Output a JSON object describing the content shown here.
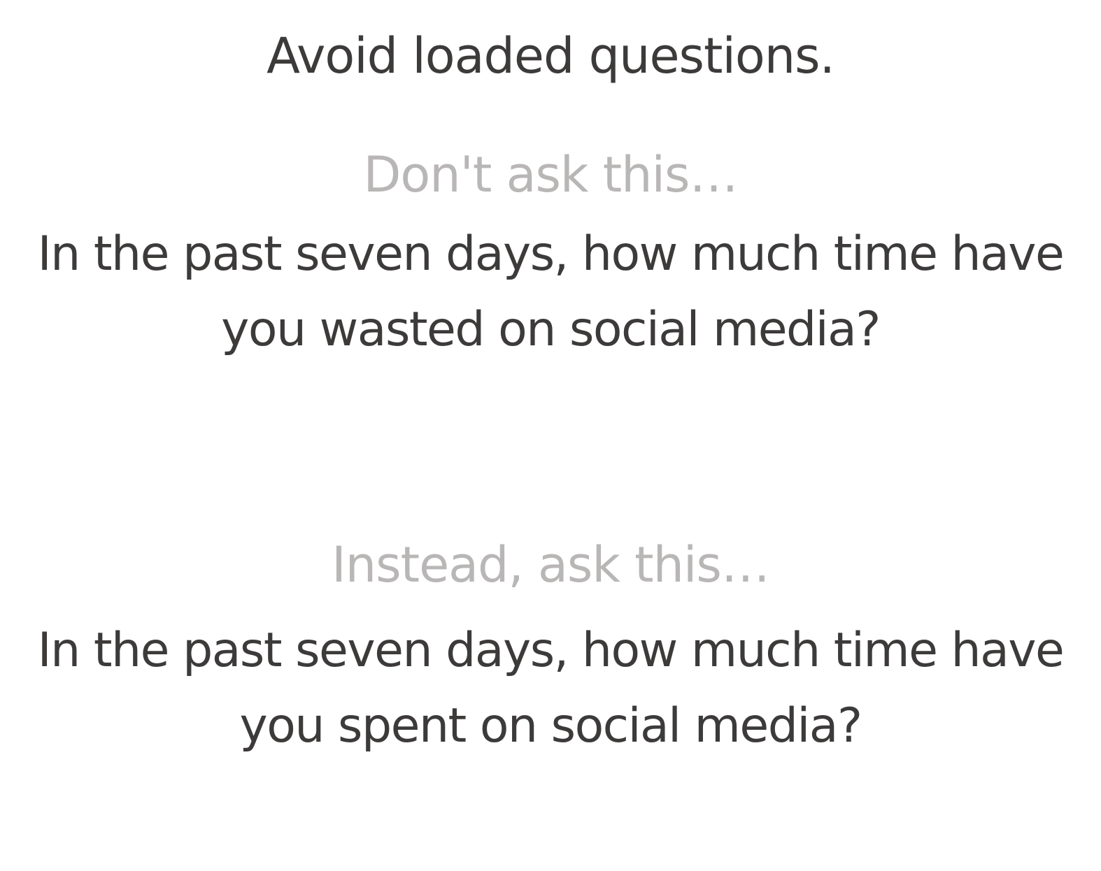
{
  "slide": {
    "title": "Avoid loaded questions.",
    "dont": {
      "label": "Don't ask this…",
      "question_lines": [
        "In the past seven days, how much time have",
        "you wasted on social media?"
      ]
    },
    "instead": {
      "label": "Instead, ask this…",
      "question_lines": [
        "In the past seven days, how much time have",
        "you spent on social media?"
      ]
    }
  },
  "colors": {
    "background": "#ffffff",
    "text": "#3d3a3a",
    "label": "#b9b6b6"
  }
}
